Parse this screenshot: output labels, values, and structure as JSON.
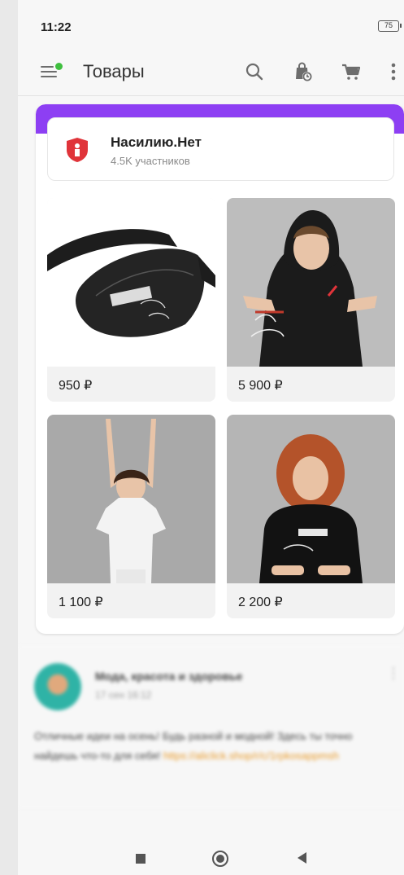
{
  "status_bar": {
    "time": "11:22",
    "battery": "75"
  },
  "toolbar": {
    "title": "Товары",
    "icons": [
      "menu-icon",
      "search-icon",
      "shopping-bag-icon",
      "cart-icon",
      "more-icon"
    ]
  },
  "community": {
    "name": "Насилию.Нет",
    "members": "4.5K участников",
    "accent": "#8d3ff3",
    "logo_color": "#e0343a"
  },
  "products": [
    {
      "price": "950 ₽",
      "image": "black belt bag printed 'make love not violence'"
    },
    {
      "price": "5 900 ₽",
      "image": "man in black hoodie printed 'make love not violence'"
    },
    {
      "price": "1 100 ₽",
      "image": "woman in white t-shirt with arms raised"
    },
    {
      "price": "2 200 ₽",
      "image": "red-haired woman in black t-shirt"
    }
  ],
  "post": {
    "author": "Мода, красота и здоровье",
    "date": "17 сен 16:12",
    "text": "Отличные идеи на осень! Будь разной и модной! Здесь ты точно найдешь что-то для себя!",
    "link": "https://aliclick.shop/r/c/1rpkosappmsh"
  }
}
